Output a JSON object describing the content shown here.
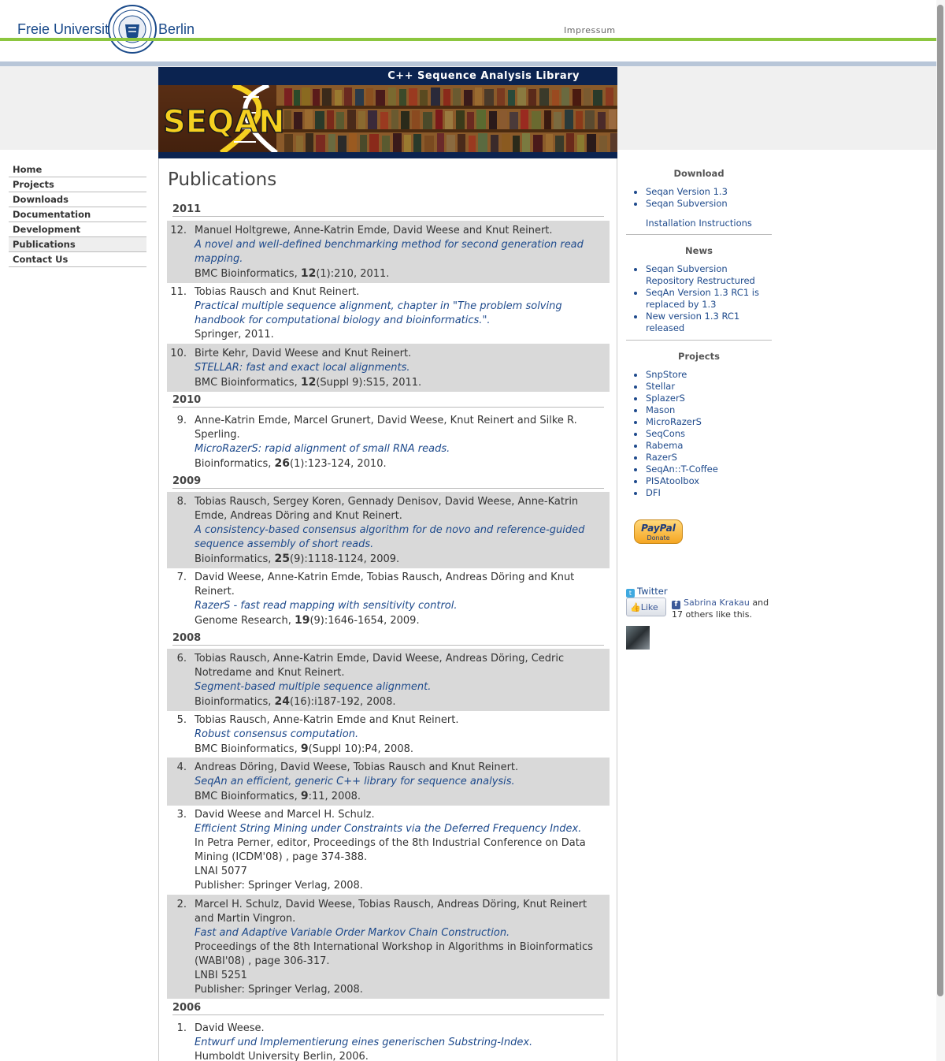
{
  "top": {
    "logo_left": "Freie Universität",
    "logo_right": "Berlin",
    "impressum": "Impressum"
  },
  "banner": {
    "title": "C++ Sequence Analysis Library",
    "logo_text": "SEQAN"
  },
  "nav": [
    {
      "label": "Home"
    },
    {
      "label": "Projects"
    },
    {
      "label": "Downloads"
    },
    {
      "label": "Documentation"
    },
    {
      "label": "Development"
    },
    {
      "label": "Publications",
      "active": true
    },
    {
      "label": "Contact Us"
    }
  ],
  "page_title": "Publications",
  "years": [
    "2011",
    "2010",
    "2009",
    "2008",
    "2006"
  ],
  "publications": [
    {
      "num": "12.",
      "authors": "Manuel Holtgrewe, Anne-Katrin Emde, David Weese and Knut Reinert.",
      "title": "A novel and well-defined benchmarking method for second generation read mapping.",
      "venue_pre": "BMC Bioinformatics, ",
      "volume": "12",
      "venue_post": "(1):210, 2011."
    },
    {
      "num": "11.",
      "authors": "Tobias Rausch and Knut Reinert.",
      "title": "Practical multiple sequence alignment, chapter in \"The problem solving handbook for computational biology and bioinformatics.\".",
      "venue_pre": "Springer, 2011.",
      "volume": "",
      "venue_post": ""
    },
    {
      "num": "10.",
      "authors": "Birte Kehr, David Weese and Knut Reinert.",
      "title": "STELLAR: fast and exact local alignments.",
      "venue_pre": "BMC Bioinformatics, ",
      "volume": "12",
      "venue_post": "(Suppl 9):S15, 2011."
    },
    {
      "num": "9.",
      "authors": "Anne-Katrin Emde, Marcel Grunert, David Weese, Knut Reinert and Silke R. Sperling.",
      "title": "MicroRazerS: rapid alignment of small RNA reads.",
      "venue_pre": "Bioinformatics, ",
      "volume": "26",
      "venue_post": "(1):123-124, 2010."
    },
    {
      "num": "8.",
      "authors": "Tobias Rausch, Sergey Koren, Gennady Denisov, David Weese, Anne-Katrin Emde, Andreas Döring and Knut Reinert.",
      "title": "A consistency-based consensus algorithm for de novo and reference-guided sequence assembly of short reads.",
      "venue_pre": "Bioinformatics, ",
      "volume": "25",
      "venue_post": "(9):1118-1124, 2009."
    },
    {
      "num": "7.",
      "authors": "David Weese, Anne-Katrin Emde, Tobias Rausch, Andreas Döring and Knut Reinert.",
      "title": "RazerS - fast read mapping with sensitivity control.",
      "venue_pre": "Genome Research, ",
      "volume": "19",
      "venue_post": "(9):1646-1654, 2009."
    },
    {
      "num": "6.",
      "authors": "Tobias Rausch, Anne-Katrin Emde, David Weese, Andreas Döring, Cedric Notredame and Knut Reinert.",
      "title": "Segment-based multiple sequence alignment.",
      "venue_pre": "Bioinformatics, ",
      "volume": "24",
      "venue_post": "(16):i187-192, 2008."
    },
    {
      "num": "5.",
      "authors": "Tobias Rausch, Anne-Katrin Emde and Knut Reinert.",
      "title": "Robust consensus computation.",
      "venue_pre": "BMC Bioinformatics, ",
      "volume": "9",
      "venue_post": "(Suppl 10):P4, 2008."
    },
    {
      "num": "4.",
      "authors": "Andreas Döring, David Weese, Tobias Rausch and Knut Reinert.",
      "title": "SeqAn an efficient, generic C++ library for sequence analysis.",
      "venue_pre": "BMC Bioinformatics, ",
      "volume": "9",
      "venue_post": ":11, 2008."
    },
    {
      "num": "3.",
      "authors": "David Weese and Marcel H. Schulz.",
      "title": "Efficient String Mining under Constraints via the Deferred Frequency Index.",
      "venue_pre": "In Petra Perner, editor, Proceedings of the 8th Industrial Conference on Data Mining (ICDM'08) , page 374-388.",
      "volume": "",
      "venue_post": "",
      "extra1": "LNAI 5077",
      "extra2": "Publisher: Springer Verlag, 2008."
    },
    {
      "num": "2.",
      "authors": "Marcel H. Schulz, David Weese, Tobias Rausch, Andreas Döring, Knut Reinert and Martin Vingron.",
      "title": "Fast and Adaptive Variable Order Markov Chain Construction.",
      "venue_pre": "Proceedings of the 8th International Workshop in Algorithms in Bioinformatics (WABI'08) , page 306-317.",
      "volume": "",
      "venue_post": "",
      "extra1": "LNBI 5251",
      "extra2": "Publisher: Springer Verlag, 2008."
    },
    {
      "num": "1.",
      "authors": "David Weese.",
      "title": "Entwurf und Implementierung eines generischen Substring-Index.",
      "venue_pre": "Humboldt University Berlin, 2006.",
      "volume": "",
      "venue_post": ""
    }
  ],
  "sidebar": {
    "download_heading": "Download",
    "download_items": [
      "Seqan Version 1.3",
      "Seqan Subversion"
    ],
    "install_link": "Installation Instructions",
    "news_heading": "News",
    "news_items": [
      "Seqan Subversion Repository Restructured",
      "SeqAn Version 1.3 RC1 is replaced by 1.3",
      "New version 1.3 RC1 released"
    ],
    "projects_heading": "Projects",
    "projects_items": [
      "SnpStore",
      "Stellar",
      "SplazerS",
      "Mason",
      "MicroRazerS",
      "SeqCons",
      "Rabema",
      "RazerS",
      "SeqAn::T-Coffee",
      "PISAtoolbox",
      "DFI"
    ],
    "paypal_brand": "PayPal",
    "paypal_label": "Donate",
    "twitter_label": "Twitter",
    "like_label": "Like",
    "fb_name": "Sabrina Krakau",
    "fb_rest": " and 17 others like this."
  },
  "colors": {
    "link": "#1e4a8c",
    "green_line": "#8cc63f",
    "banner_bg": "#0b2350",
    "shade": "#d9d9d9"
  }
}
